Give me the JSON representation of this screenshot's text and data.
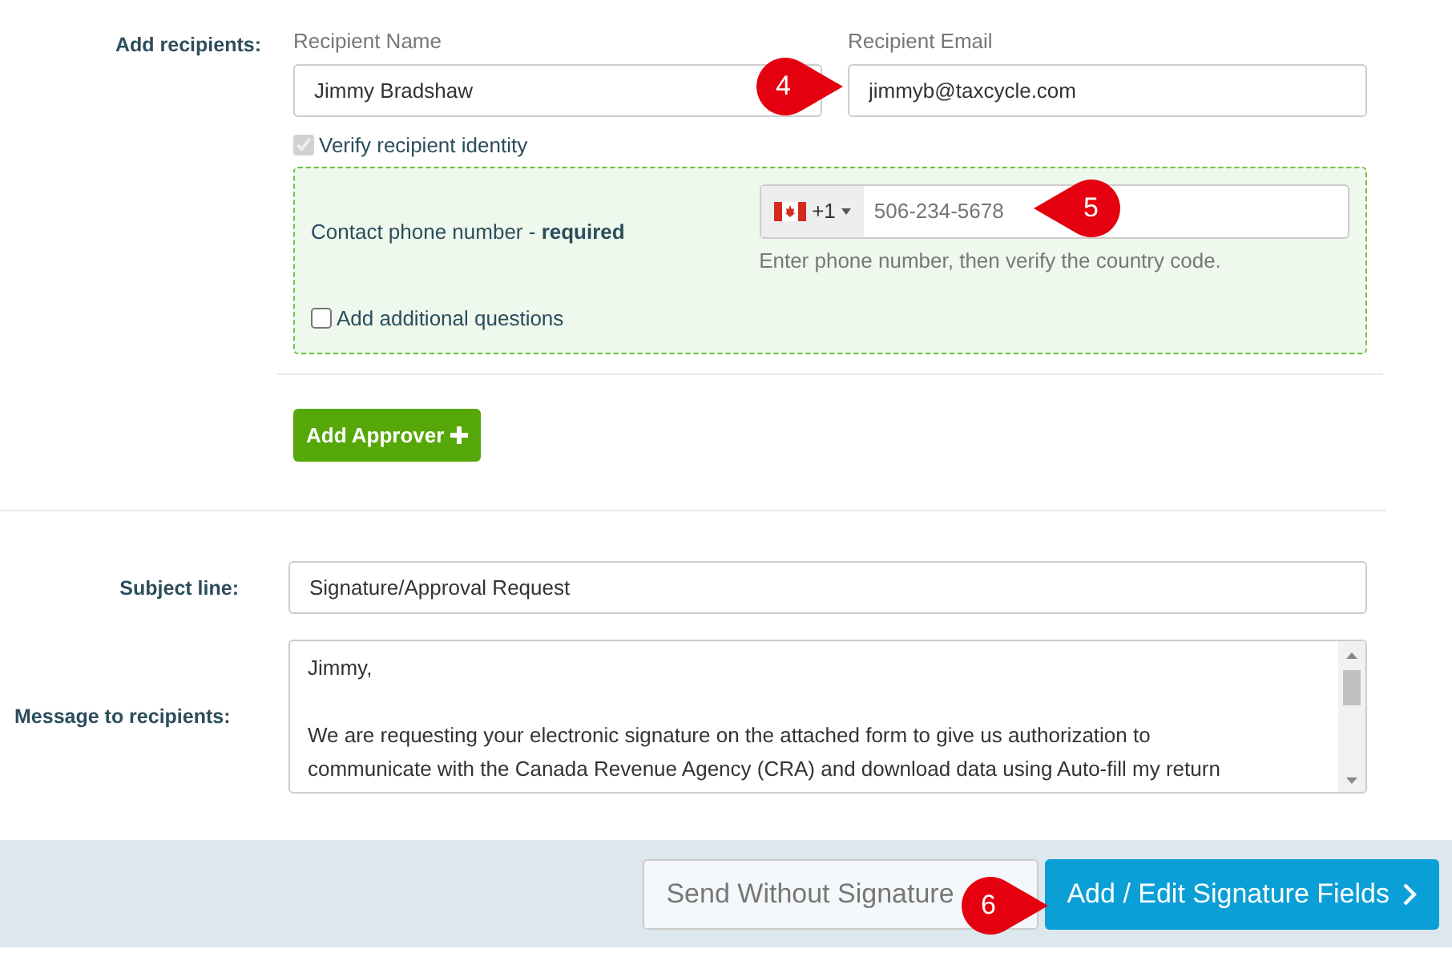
{
  "recipients": {
    "label": "Add recipients:",
    "name_field": {
      "label": "Recipient Name",
      "value": "Jimmy Bradshaw"
    },
    "email_field": {
      "label": "Recipient Email",
      "value": "jimmyb@taxcycle.com"
    },
    "verify": {
      "label": "Verify recipient identity",
      "checked": true,
      "disabled": true
    },
    "verification": {
      "phone_label": "Contact phone number - **required**",
      "country_code": "+1",
      "phone_placeholder": "506-234-5678",
      "hint": "Enter phone number, then verify the country code.",
      "additional_questions": {
        "label": "Add additional questions",
        "checked": false
      }
    },
    "add_approver": "Add Approver"
  },
  "subject": {
    "label": "Subject line:",
    "value": "Signature/Approval Request"
  },
  "message": {
    "label": "Message to recipients:",
    "lines": [
      "Jimmy,",
      "We are requesting your electronic signature on the attached form to give us authorization to",
      "communicate with the Canada Revenue Agency (CRA) and download data using Auto-fill my return"
    ]
  },
  "footer": {
    "buttons": [
      {
        "label": "Send Without Signature",
        "kind": "secondary"
      },
      {
        "label": "Add / Edit Signature Fields",
        "kind": "primary"
      }
    ]
  },
  "callouts": [
    {
      "number": "4"
    },
    {
      "number": "5"
    },
    {
      "number": "6"
    }
  ]
}
